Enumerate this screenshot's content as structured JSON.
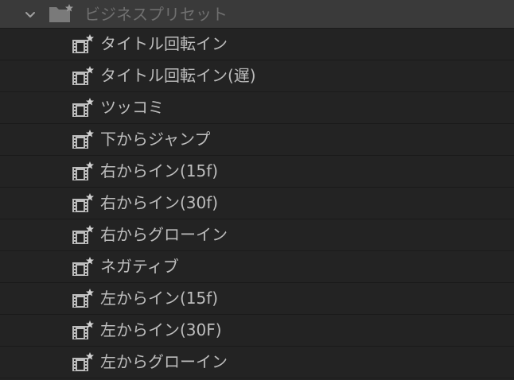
{
  "folder": {
    "icon": "folder-preset-icon",
    "label": "ビジネスプリセット",
    "expanded": true
  },
  "items": [
    {
      "label": "タイトル回転イン",
      "icon": "preset-clip-icon"
    },
    {
      "label": "タイトル回転イン(遅)",
      "icon": "preset-clip-icon"
    },
    {
      "label": "ツッコミ",
      "icon": "preset-clip-icon"
    },
    {
      "label": "下からジャンプ",
      "icon": "preset-clip-icon"
    },
    {
      "label": "右からイン(15f)",
      "icon": "preset-clip-icon"
    },
    {
      "label": "右からイン(30f)",
      "icon": "preset-clip-icon"
    },
    {
      "label": "右からグローイン",
      "icon": "preset-clip-icon"
    },
    {
      "label": "ネガティブ",
      "icon": "preset-clip-icon"
    },
    {
      "label": "左からイン(15f)",
      "icon": "preset-clip-icon"
    },
    {
      "label": "左からイン(30F)",
      "icon": "preset-clip-icon"
    },
    {
      "label": "左からグローイン",
      "icon": "preset-clip-icon"
    }
  ],
  "colors": {
    "background": "#232323",
    "folder_row": "#3a3a3a",
    "label_text": "#bdbdbd",
    "folder_text": "#6f6f6f"
  }
}
